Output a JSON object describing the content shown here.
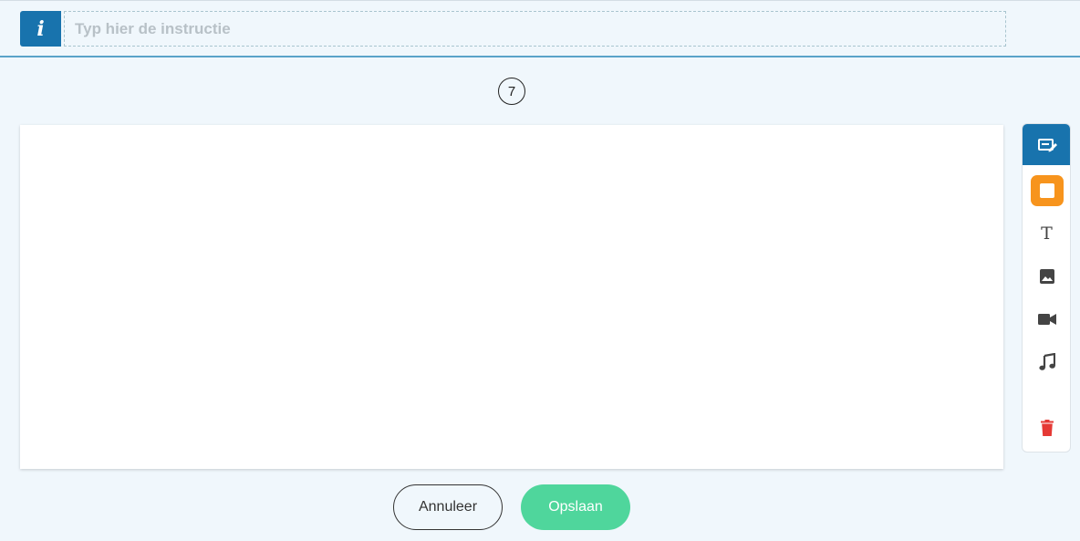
{
  "instruction": {
    "badge": "i",
    "placeholder": "Typ hier de instructie",
    "value": ""
  },
  "step": {
    "number": "7"
  },
  "toolbar": {
    "tools": [
      {
        "name": "edit-tool",
        "icon": "edit-icon",
        "active": true
      },
      {
        "name": "shape-tool",
        "icon": "square-icon",
        "color": "#f7941d"
      },
      {
        "name": "text-tool",
        "icon": "text-icon",
        "glyph": "T"
      },
      {
        "name": "image-tool",
        "icon": "image-icon"
      },
      {
        "name": "video-tool",
        "icon": "video-icon"
      },
      {
        "name": "audio-tool",
        "icon": "music-icon"
      },
      {
        "name": "delete-tool",
        "icon": "trash-icon",
        "color": "#e53935"
      }
    ]
  },
  "actions": {
    "cancel_label": "Annuleer",
    "save_label": "Opslaan"
  },
  "colors": {
    "primary": "#1873ad",
    "accent_orange": "#f7941d",
    "save_green": "#4fd69c",
    "danger": "#e53935",
    "background": "#f0f7fc"
  }
}
